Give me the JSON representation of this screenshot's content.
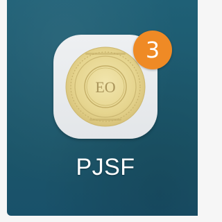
{
  "app": {
    "label": "PJSF",
    "badge_count": "3",
    "icon": "seal-emblem-icon",
    "emblem_text": "EO"
  },
  "colors": {
    "wallpaper": "#1d5a6f",
    "badge": "#ef8a25",
    "tile": "#e8eaed",
    "seal_gold": "#e8d99a"
  }
}
